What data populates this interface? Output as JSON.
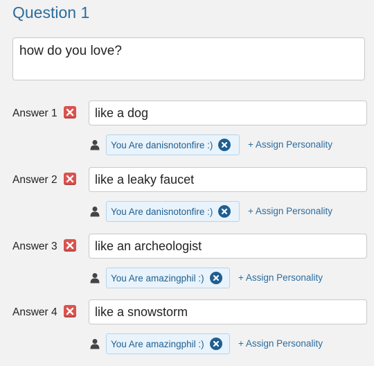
{
  "question": {
    "title": "Question 1",
    "text": "how do you love?"
  },
  "answers": [
    {
      "label": "Answer 1",
      "value": "like a dog",
      "personality_tag": "You Are danisnotonfire :)",
      "assign_link": "+ Assign Personality"
    },
    {
      "label": "Answer 2",
      "value": "like a leaky faucet",
      "personality_tag": "You Are danisnotonfire :)",
      "assign_link": "+ Assign Personality"
    },
    {
      "label": "Answer 3",
      "value": "like an archeologist",
      "personality_tag": "You Are amazingphil :)",
      "assign_link": "+ Assign Personality"
    },
    {
      "label": "Answer 4",
      "value": "like a snowstorm",
      "personality_tag": "You Are amazingphil :)",
      "assign_link": "+ Assign Personality"
    }
  ],
  "icons": {
    "delete": "delete-x-icon",
    "person": "person-icon",
    "tag_close": "close-circle-icon"
  },
  "colors": {
    "title": "#2b6c9e",
    "delete": "#d9534f",
    "tag_bg": "#e9f3fb",
    "tag_border": "#b6d3ea",
    "tag_text": "#1f5f91",
    "link": "#2b6c9e"
  }
}
